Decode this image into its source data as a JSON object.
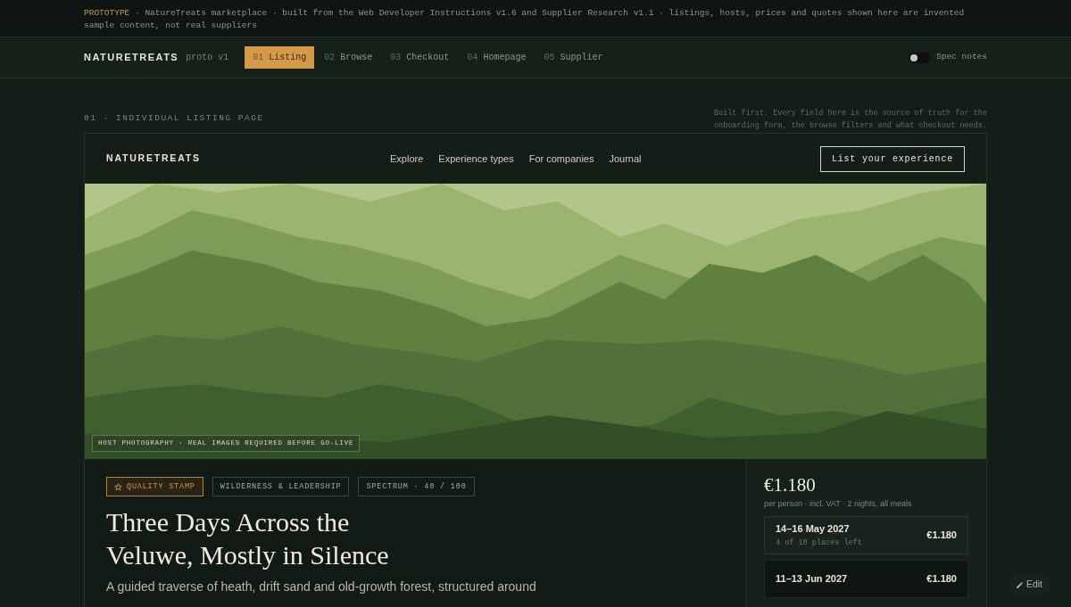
{
  "banner": {
    "tag": "PROTOTYPE",
    "text": "· NatureTreats marketplace · built from the Web Developer Instructions v1.6 and Supplier Research v1.1 · listings, hosts, prices and quotes shown here are invented sample content, not real suppliers"
  },
  "proto_nav": {
    "brand": "NATURETREATS",
    "version": "proto v1",
    "tabs": [
      {
        "number": "01",
        "label": "Listing",
        "selected": true
      },
      {
        "number": "02",
        "label": "Browse",
        "selected": false
      },
      {
        "number": "03",
        "label": "Checkout",
        "selected": false
      },
      {
        "number": "04",
        "label": "Homepage",
        "selected": false
      },
      {
        "number": "05",
        "label": "Supplier",
        "selected": false
      }
    ],
    "spec_notes": {
      "label": "Spec notes",
      "on": false
    }
  },
  "section": {
    "label": "01 · INDIVIDUAL LISTING PAGE",
    "note": "Built first. Every field here is the source of truth for the onboarding form, the browse filters and what checkout needs."
  },
  "site_nav": {
    "brand": "NATURETREATS",
    "links": [
      "Explore",
      "Experience types",
      "For companies",
      "Journal"
    ],
    "cta": "List your experience"
  },
  "hero": {
    "kind": "picture",
    "caption": "HOST PHOTOGRAPHY · REAL IMAGES REQUIRED BEFORE GO-LIVE"
  },
  "listing": {
    "tags": [
      {
        "kind": "stamp",
        "label": "QUALITY STAMP"
      },
      {
        "kind": "plain",
        "label": "WILDERNESS & LEADERSHIP"
      },
      {
        "kind": "plain",
        "label": "SPECTRUM · 40 / 100"
      }
    ],
    "title": "Three Days Across the Veluwe, Mostly in Silence",
    "intro": "A guided traverse of heath, drift sand and old-growth forest, structured around"
  },
  "booking": {
    "price": "€1.180",
    "price_note": "per person · incl. VAT · 2 nights, all meals",
    "dates": [
      {
        "dates": "14–16 May 2027",
        "places": "4 of 10 places left",
        "price": "€1.180",
        "selected": false
      },
      {
        "dates": "11–13 Jun 2027",
        "price": "€1.180",
        "selected": true
      }
    ]
  },
  "edit_button": "Edit"
}
